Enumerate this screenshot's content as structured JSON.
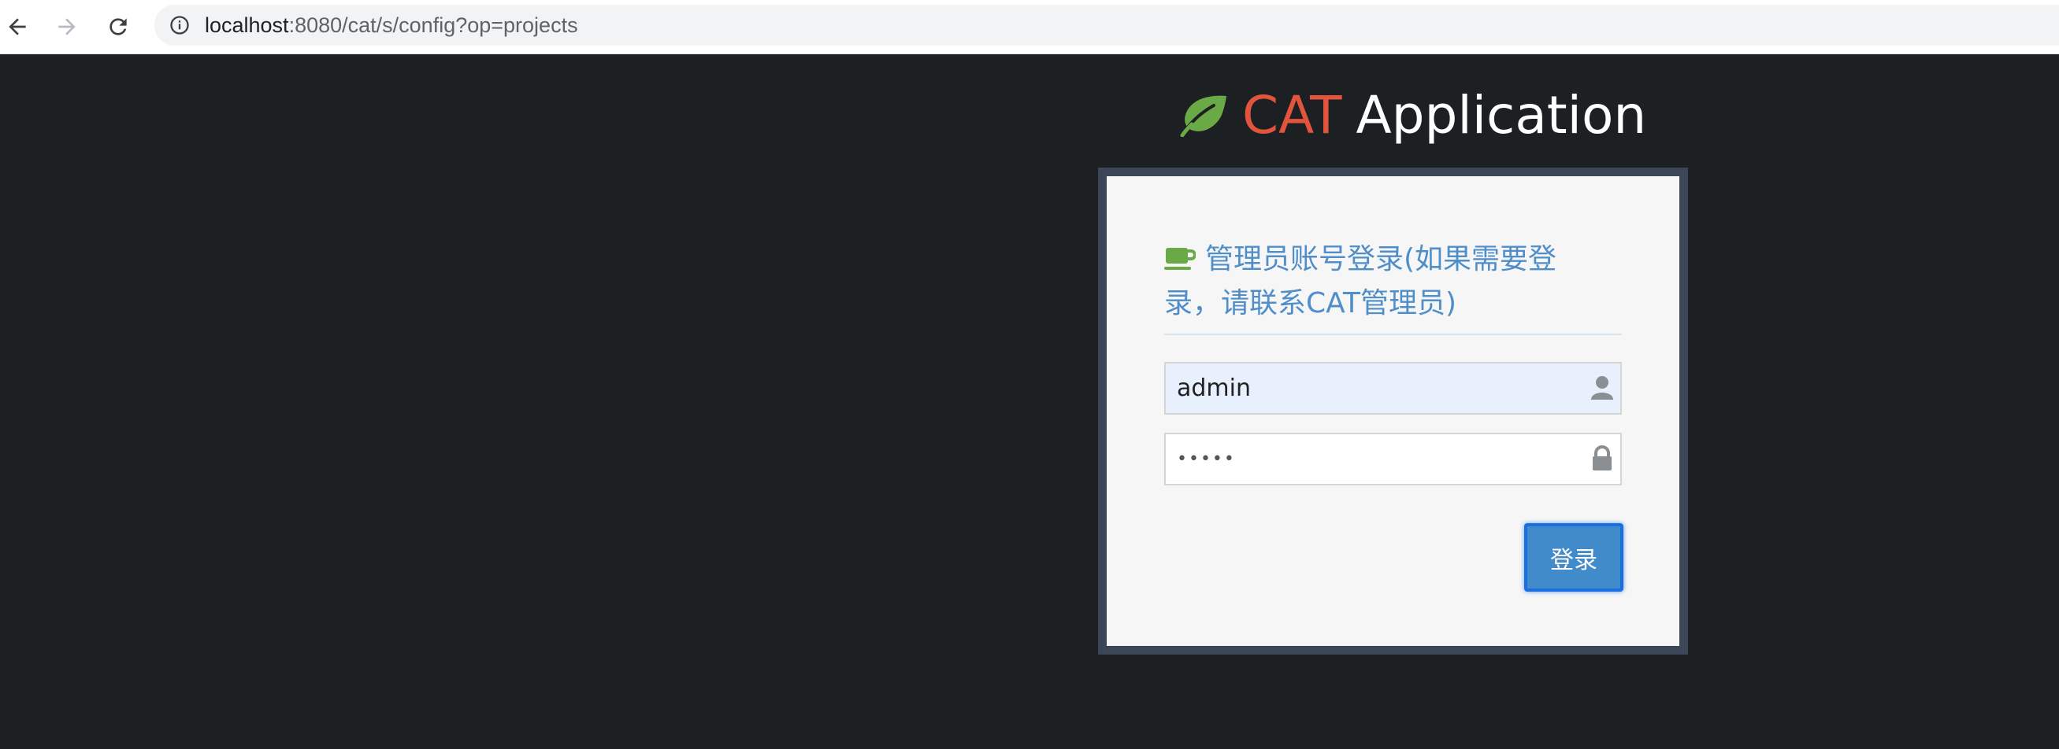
{
  "browser": {
    "url_host": "localhost",
    "url_rest": ":8080/cat/s/config?op=projects",
    "back_icon": "arrow-left-icon",
    "forward_icon": "arrow-right-icon",
    "reload_icon": "reload-icon",
    "info_icon": "info-icon"
  },
  "app": {
    "title_cat": "CAT",
    "title_app": "Application",
    "logo_icon": "leaf-icon",
    "colors": {
      "cat_red": "#e2553c",
      "leaf_green": "#69aa46",
      "accent_blue": "#4f8ec9"
    }
  },
  "login": {
    "header_line1": "管理员账号登录(如果需要登",
    "header_line2": "录，请联系CAT管理员)",
    "header_icon": "coffee-cup-icon",
    "username_value": "admin",
    "password_value": "•••••",
    "username_icon": "user-icon",
    "password_icon": "lock-icon",
    "submit_label": "登录"
  }
}
